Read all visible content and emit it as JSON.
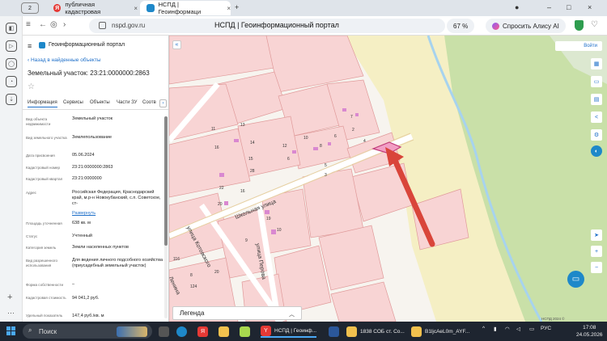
{
  "browser": {
    "tab_count": "2",
    "tabs": [
      {
        "label": "публичная кадастровая"
      },
      {
        "label": "НСПД | Геоинформаци"
      }
    ],
    "url": "nspd.gov.ru",
    "page_title": "НСПД | Геоинформационный портал",
    "zoom": "67 %",
    "alice_label": "Спросить Алису AI"
  },
  "panel": {
    "portal_title": "Геоинформационный портал",
    "back_link": "Назад в найденные объекты",
    "object_title": "Земельный участок: 23:21:0000000:2863",
    "tabs": [
      "Информация",
      "Сервисы",
      "Объекты",
      "Части ЗУ",
      "Соотв"
    ],
    "rows": [
      {
        "label": "Вид объекта недвижимости",
        "value": "Земельный участок"
      },
      {
        "label": "Вид земельного участка",
        "value": "Землепользование"
      },
      {
        "label": "Дата присвоения",
        "value": "05.06.2024"
      },
      {
        "label": "Кадастровый номер",
        "value": "23:21:0000000:2863"
      },
      {
        "label": "Кадастровый квартал",
        "value": "23:21:0000000"
      },
      {
        "label": "Адрес",
        "value": "Российская Федерация, Краснодарский край, м.р-н Новокубанский, с.п. Советское, ст-"
      },
      {
        "label": "Площадь уточненная",
        "value": "638 кв. м"
      },
      {
        "label": "Статус",
        "value": "Учтенный"
      },
      {
        "label": "Категория земель",
        "value": "Земли населенных пунктов"
      },
      {
        "label": "Вид разрешенного использования",
        "value": "Для ведения личного подсобного хозяйства (приусадебный земельный участок)"
      },
      {
        "label": "Форма собственности",
        "value": "–"
      },
      {
        "label": "Кадастровая стоимость",
        "value": "94 041,2 руб."
      },
      {
        "label": "Удельный показатель",
        "value": "147,4 руб./кв. м"
      }
    ],
    "expand_link": "Развернуть"
  },
  "map": {
    "login_label": "Войти",
    "legend_label": "Легенда",
    "scale_text": "НСПД 2024 ©",
    "streets": {
      "shkolnaya": "Школьная улица",
      "kotovskogo": "улица Котовского",
      "lenina": "Ленина",
      "perova": "улица Перова"
    },
    "house_numbers": [
      "11",
      "13",
      "7",
      "2",
      "16",
      "14",
      "12",
      "10",
      "8",
      "6",
      "4",
      "6",
      "5",
      "15",
      "3",
      "22",
      "20",
      "16",
      "28",
      "10",
      "19",
      "9",
      "8",
      "20",
      "116",
      "124"
    ]
  },
  "taskbar": {
    "search_label": "Поиск",
    "apps": [
      {
        "label": "НСПД | Геоинф..."
      },
      {
        "label": "1838 СОБ ст. Со..."
      },
      {
        "label": "B1ljcAeL0m_AYF..."
      }
    ],
    "lang": "РУС",
    "time": "17:08",
    "date": "24.05.2026"
  },
  "colors": {
    "accent": "#1e6fc9",
    "parcel_fill": "#f8d4d4",
    "parcel_stroke": "#e09a9a",
    "highlight": "#e86a9a",
    "arrow": "#d9453a",
    "field_green": "#c9e0a8",
    "sand": "#f5efc4"
  }
}
